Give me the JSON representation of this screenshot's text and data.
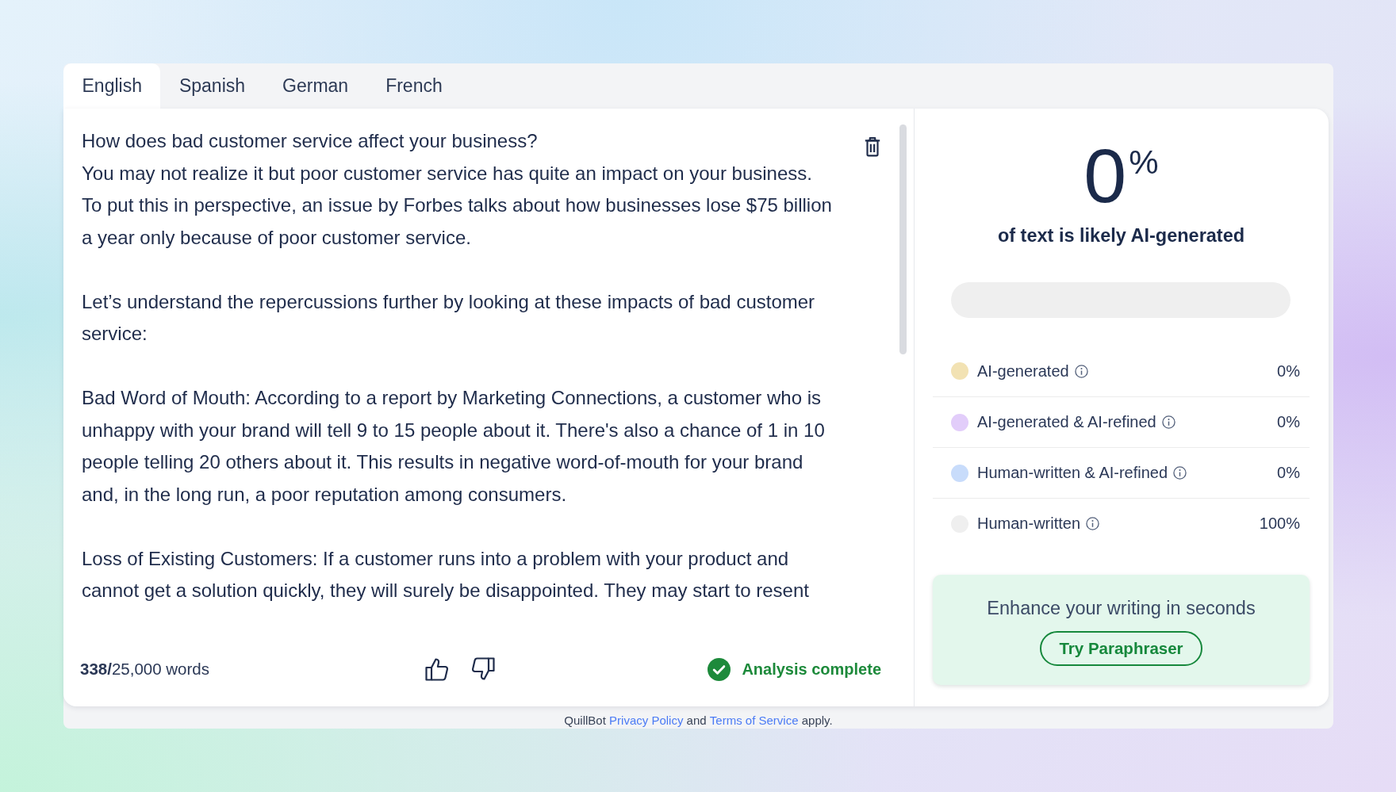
{
  "tabs": [
    {
      "label": "English",
      "selected": true
    },
    {
      "label": "Spanish",
      "selected": false
    },
    {
      "label": "German",
      "selected": false
    },
    {
      "label": "French",
      "selected": false
    }
  ],
  "editor": {
    "paragraphs": [
      [
        "How does bad customer service affect your business?",
        "You may not realize it but poor customer service has quite an impact on your business.",
        "To put this in perspective, an issue by Forbes talks about how businesses lose $75 billion",
        "a year only because of poor customer service."
      ],
      [
        "Let’s understand the repercussions further by looking at these impacts of bad customer",
        "service:"
      ],
      [
        "Bad Word of Mouth: According to a report by Marketing Connections, a customer who is",
        "unhappy with your brand will tell 9 to 15 people about it. There's also a chance of 1 in 10",
        "people telling 20 others about it. This results in negative word-of-mouth for your brand",
        "and, in the long run, a poor reputation among consumers."
      ],
      [
        "Loss of Existing Customers: If a customer runs into a problem with your product and",
        "cannot get a solution quickly, they will surely be disappointed. They may start to resent"
      ]
    ],
    "word_count": "**338/**25,000 words",
    "status": "Analysis complete"
  },
  "result": {
    "score": "0",
    "unit": "%",
    "caption": "of text is likely AI-generated",
    "categories": [
      {
        "label": "AI-generated",
        "value": "0%",
        "color": "#f2e2b3",
        "level": 0
      },
      {
        "label": "AI-generated & AI-refined",
        "value": "0%",
        "color": "#e2cdfa",
        "level": 0
      },
      {
        "label": "Human-written & AI-refined",
        "value": "0%",
        "color": "#c8dcfb",
        "level": 0
      },
      {
        "label": "Human-written",
        "value": "100%",
        "color": "#efefef",
        "level": 1
      }
    ]
  },
  "promo": {
    "text": "Enhance your writing in seconds",
    "button": "Try Paraphraser"
  },
  "footer": [
    {
      "kind": "text",
      "text": "QuillBot"
    },
    {
      "kind": "link",
      "text": "Privacy Policy"
    },
    {
      "kind": "text",
      "text": "and"
    },
    {
      "kind": "link",
      "text": "Terms of Service"
    },
    {
      "kind": "text",
      "text": "apply."
    }
  ]
}
